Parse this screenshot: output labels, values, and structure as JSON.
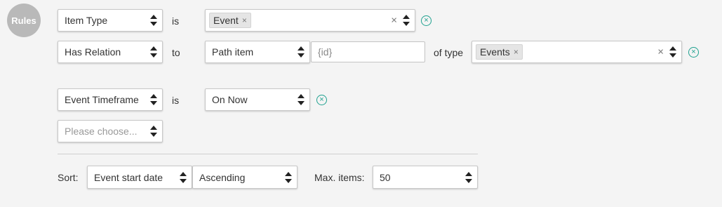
{
  "badge": "Rules",
  "rows": {
    "r1": {
      "field": "Item Type",
      "op": "is",
      "tag": "Event",
      "tag_x": "×",
      "clear": "×"
    },
    "r2": {
      "field": "Has Relation",
      "op": "to",
      "target": "Path item",
      "id_value": "{id}",
      "type_label": "of type",
      "tag": "Events",
      "tag_x": "×",
      "clear": "×"
    },
    "r3": {
      "field": "Event Timeframe",
      "op": "is",
      "value": "On Now"
    },
    "r4": {
      "placeholder": "Please choose..."
    }
  },
  "sort": {
    "label": "Sort:",
    "field": "Event start date",
    "order": "Ascending",
    "max_label": "Max. items:",
    "max_value": "50"
  },
  "remove_glyph": "×"
}
